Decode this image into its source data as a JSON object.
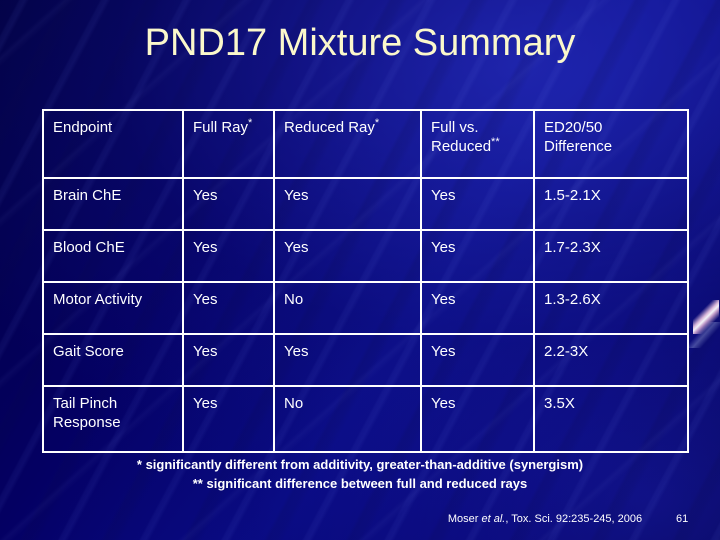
{
  "slide": {
    "title": "PND17 Mixture Summary",
    "number": "61"
  },
  "table": {
    "columns": [
      {
        "label": "Endpoint"
      },
      {
        "label": "Full Ray",
        "marker": "*"
      },
      {
        "label": "Reduced Ray",
        "marker": "*"
      },
      {
        "label": "Full vs. Reduced",
        "marker": "**"
      },
      {
        "label": "ED20/50 Difference"
      }
    ],
    "header": {
      "c0": "Endpoint",
      "c1_text": "Full Ray",
      "c1_marker": "*",
      "c2_text": "Reduced Ray",
      "c2_marker": "*",
      "c3_line1": "Full vs.",
      "c3_line2": "Reduced",
      "c3_marker": "**",
      "c4_line1": "ED20/50",
      "c4_line2": "Difference"
    },
    "rows": [
      {
        "endpoint": "Brain ChE",
        "full_ray": "Yes",
        "reduced_ray": "Yes",
        "full_vs_reduced": "Yes",
        "ed_difference": "1.5-2.1X"
      },
      {
        "endpoint": "Blood ChE",
        "full_ray": "Yes",
        "reduced_ray": "Yes",
        "full_vs_reduced": "Yes",
        "ed_difference": "1.7-2.3X"
      },
      {
        "endpoint": "Motor Activity",
        "full_ray": "Yes",
        "reduced_ray": "No",
        "full_vs_reduced": "Yes",
        "ed_difference": "1.3-2.6X"
      },
      {
        "endpoint": "Gait Score",
        "full_ray": "Yes",
        "reduced_ray": "Yes",
        "full_vs_reduced": "Yes",
        "ed_difference": "2.2-3X"
      },
      {
        "endpoint_line1": "Tail Pinch",
        "endpoint_line2": "Response",
        "endpoint": "Tail Pinch Response",
        "full_ray": "Yes",
        "reduced_ray": "No",
        "full_vs_reduced": "Yes",
        "ed_difference": "3.5X"
      }
    ]
  },
  "footnotes": {
    "line1": "* significantly different from additivity, greater-than-additive (synergism)",
    "line2": "** significant difference between full and reduced rays"
  },
  "citation": {
    "author": "Moser",
    "et_al": "et al.",
    "rest": ", Tox. Sci. 92:235-245, 2006"
  },
  "colors": {
    "background_deep": "#01003f",
    "background_mid": "#0a0c8c",
    "title_text": "#fbf8cb",
    "body_text": "#ffffff",
    "table_border": "#ffffff"
  }
}
